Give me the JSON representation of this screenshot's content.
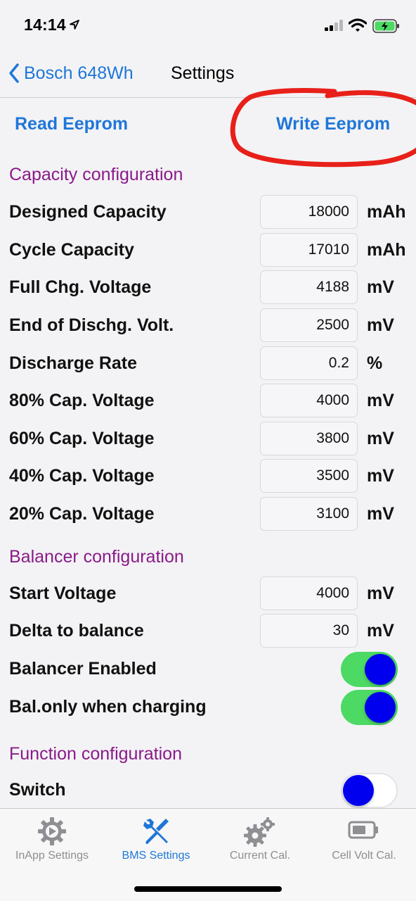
{
  "status": {
    "time": "14:14"
  },
  "nav": {
    "back_label": "Bosch 648Wh",
    "title": "Settings"
  },
  "actions": {
    "read": "Read Eeprom",
    "write": "Write Eeprom"
  },
  "capacity": {
    "title": "Capacity configuration",
    "rows": [
      {
        "label": "Designed Capacity",
        "value": "18000",
        "unit": "mAh"
      },
      {
        "label": "Cycle Capacity",
        "value": "17010",
        "unit": "mAh"
      },
      {
        "label": "Full Chg. Voltage",
        "value": "4188",
        "unit": "mV"
      },
      {
        "label": "End of Dischg. Volt.",
        "value": "2500",
        "unit": "mV"
      },
      {
        "label": "Discharge Rate",
        "value": "0.2",
        "unit": "%"
      },
      {
        "label": "80% Cap. Voltage",
        "value": "4000",
        "unit": "mV"
      },
      {
        "label": "60% Cap. Voltage",
        "value": "3800",
        "unit": "mV"
      },
      {
        "label": "40% Cap. Voltage",
        "value": "3500",
        "unit": "mV"
      },
      {
        "label": "20% Cap. Voltage",
        "value": "3100",
        "unit": "mV"
      }
    ]
  },
  "balancer": {
    "title": "Balancer configuration",
    "rows": [
      {
        "label": "Start Voltage",
        "value": "4000",
        "unit": "mV"
      },
      {
        "label": "Delta to balance",
        "value": "30",
        "unit": "mV"
      }
    ],
    "toggles": [
      {
        "label": "Balancer Enabled",
        "on": true
      },
      {
        "label": "Bal.only when charging",
        "on": true
      }
    ]
  },
  "function": {
    "title": "Function configuration",
    "toggles": [
      {
        "label": "Switch",
        "on": false
      }
    ]
  },
  "tabs": [
    {
      "label": "InApp Settings",
      "icon": "gear-icon",
      "active": false
    },
    {
      "label": "BMS Settings",
      "icon": "tools-icon",
      "active": true
    },
    {
      "label": "Current Cal.",
      "icon": "gears-icon",
      "active": false
    },
    {
      "label": "Cell Volt Cal.",
      "icon": "battery-icon",
      "active": false
    }
  ],
  "colors": {
    "accent": "#1f76d8",
    "section": "#8a1a8a",
    "toggle_on": "#4cd964",
    "knob": "#0000ee",
    "annotation": "#e8201a"
  }
}
